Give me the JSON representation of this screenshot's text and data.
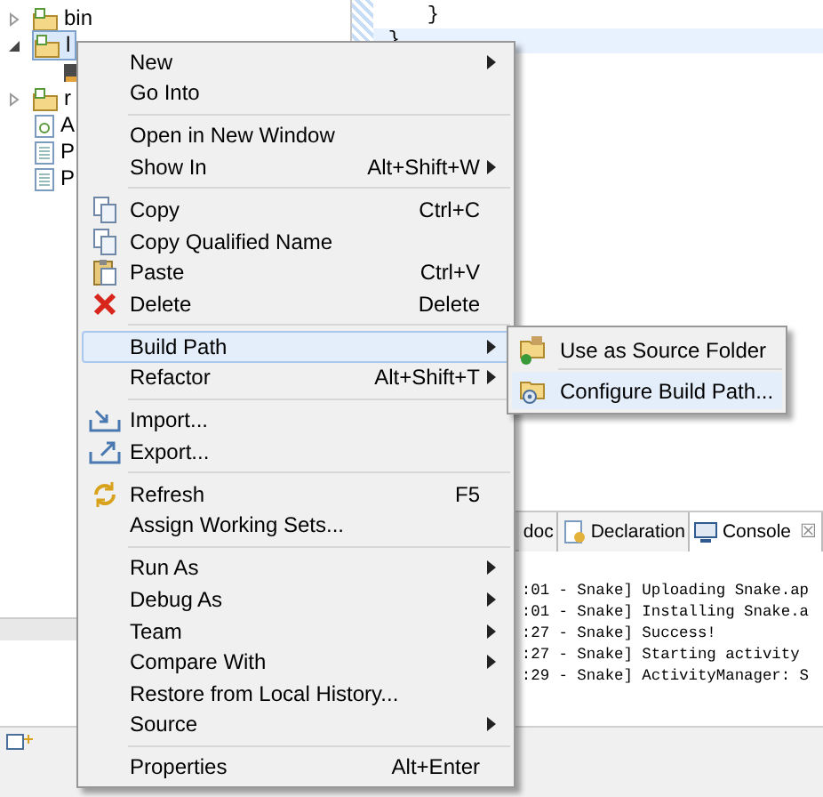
{
  "tree": {
    "items": [
      {
        "label": "bin",
        "kind": "folder",
        "expanded": false,
        "selected": false
      },
      {
        "label": "l",
        "kind": "folder",
        "expanded": true,
        "selected": true,
        "children": [
          {
            "kind": "jar"
          }
        ]
      },
      {
        "label": "r",
        "kind": "folder",
        "expanded": false,
        "selected": false
      },
      {
        "label": "A",
        "kind": "android-file",
        "selected": false
      },
      {
        "label": "P",
        "kind": "file",
        "selected": false
      },
      {
        "label": "P",
        "kind": "file",
        "selected": false
      }
    ]
  },
  "editor": {
    "lines": [
      {
        "text": "}",
        "current": false
      },
      {
        "text": "}",
        "current": true
      }
    ]
  },
  "console": {
    "tabs": [
      {
        "label": "doc",
        "kind": "plain",
        "selected": false
      },
      {
        "label": "Declaration",
        "kind": "declaration",
        "selected": false
      },
      {
        "label": "Console",
        "kind": "console",
        "selected": true,
        "closable": true
      }
    ],
    "close_glyph": "☒",
    "lines": [
      ":01 - Snake] Uploading Snake.ap",
      ":01 - Snake] Installing Snake.a",
      ":27 - Snake] Success!",
      ":27 - Snake] Starting activity",
      ":29 - Snake] ActivityManager: S"
    ]
  },
  "context_menu": {
    "items": [
      {
        "kind": "item",
        "label": "New",
        "submenu": true,
        "selected": false
      },
      {
        "kind": "item",
        "label": "Go Into",
        "selected": false
      },
      {
        "kind": "separator"
      },
      {
        "kind": "item",
        "label": "Open in New Window",
        "selected": false
      },
      {
        "kind": "item",
        "label": "Show In",
        "shortcut": "Alt+Shift+W",
        "submenu": true,
        "selected": false
      },
      {
        "kind": "separator"
      },
      {
        "kind": "copy",
        "label": "Copy",
        "shortcut": "Ctrl+C",
        "selected": false
      },
      {
        "kind": "copy",
        "label": "Copy Qualified Name",
        "selected": false
      },
      {
        "kind": "paste",
        "label": "Paste",
        "shortcut": "Ctrl+V",
        "selected": false
      },
      {
        "kind": "delete",
        "label": "Delete",
        "shortcut": "Delete",
        "selected": false
      },
      {
        "kind": "separator"
      },
      {
        "kind": "item",
        "label": "Build Path",
        "submenu": true,
        "selected": true
      },
      {
        "kind": "item",
        "label": "Refactor",
        "shortcut": "Alt+Shift+T",
        "submenu": true,
        "selected": false
      },
      {
        "kind": "separator"
      },
      {
        "kind": "import",
        "label": "Import...",
        "selected": false
      },
      {
        "kind": "export",
        "label": "Export...",
        "selected": false
      },
      {
        "kind": "separator"
      },
      {
        "kind": "refresh",
        "label": "Refresh",
        "shortcut": "F5",
        "selected": false
      },
      {
        "kind": "item",
        "label": "Assign Working Sets...",
        "selected": false
      },
      {
        "kind": "separator"
      },
      {
        "kind": "item",
        "label": "Run As",
        "submenu": true,
        "selected": false
      },
      {
        "kind": "item",
        "label": "Debug As",
        "submenu": true,
        "selected": false
      },
      {
        "kind": "item",
        "label": "Team",
        "submenu": true,
        "selected": false
      },
      {
        "kind": "item",
        "label": "Compare With",
        "submenu": true,
        "selected": false
      },
      {
        "kind": "item",
        "label": "Restore from Local History...",
        "selected": false
      },
      {
        "kind": "item",
        "label": "Source",
        "submenu": true,
        "selected": false
      },
      {
        "kind": "separator"
      },
      {
        "kind": "item",
        "label": "Properties",
        "shortcut": "Alt+Enter",
        "selected": false
      }
    ]
  },
  "submenu": {
    "items": [
      {
        "label": "Use as Source Folder",
        "kind": "source-folder",
        "selected": false
      },
      {
        "label": "Configure Build Path...",
        "kind": "build-config",
        "selected": true
      }
    ]
  }
}
